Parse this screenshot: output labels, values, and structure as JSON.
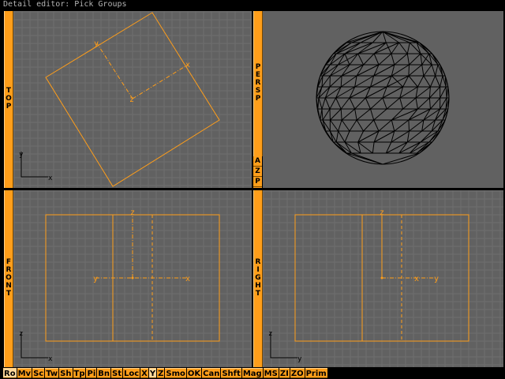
{
  "window": {
    "title": "Detail editor: Pick Groups"
  },
  "colors": {
    "accent": "#ff9e1a",
    "viewport_bg": "#616161",
    "grid": "#6e6e6e",
    "wire": "#ff9e1a"
  },
  "viewports": {
    "top": {
      "label": "TOP",
      "axis_h": "x",
      "axis_v": "y",
      "gizmo_x": "x",
      "gizmo_y": "y",
      "gizmo_z": "z"
    },
    "persp": {
      "label": "PERSP",
      "buttons": [
        "A",
        "Z",
        "P"
      ]
    },
    "front": {
      "label": "FRONT",
      "axis_h": "x",
      "axis_v": "z",
      "gizmo_x": "x",
      "gizmo_y": "y",
      "gizmo_z": "z"
    },
    "right": {
      "label": "RIGHT",
      "axis_h": "y",
      "axis_v": "z",
      "gizmo_x": "x",
      "gizmo_y": "y",
      "gizmo_z": "z"
    }
  },
  "toolbar": {
    "buttons": [
      "Ro",
      "Mv",
      "Sc",
      "Tw",
      "Sh",
      "Tp",
      "Pi",
      "Bn",
      "St",
      "Loc",
      "X",
      "Y",
      "Z",
      "Smo",
      "OK",
      "Can",
      "Shft",
      "Mag",
      "MS",
      "ZI",
      "ZO",
      "Prim"
    ],
    "active": [
      "Ro",
      "Y"
    ]
  }
}
